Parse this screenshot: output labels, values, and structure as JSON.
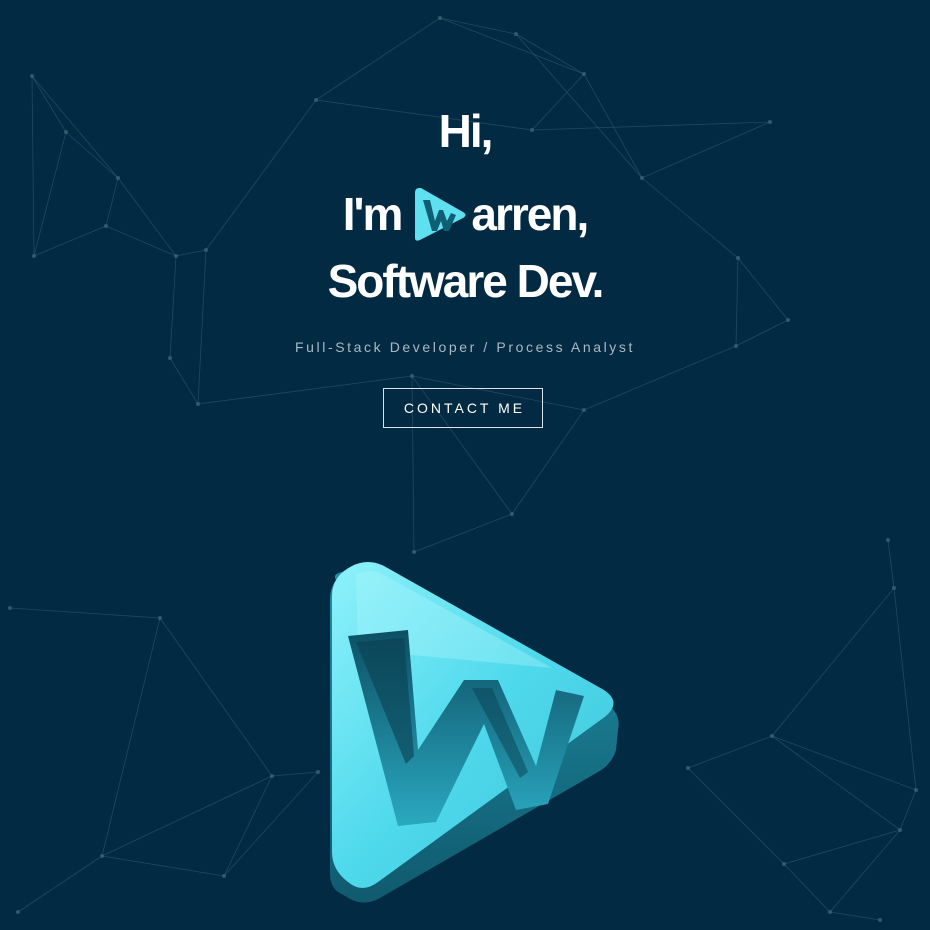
{
  "hero": {
    "greeting": "Hi,",
    "intro_prefix": "I'm",
    "intro_suffix": "arren,",
    "role_line": "Software Dev.",
    "subtitle": "Full-Stack Developer / Process Analyst"
  },
  "cta": {
    "contact_label": "CONTACT ME"
  },
  "logo": {
    "icon": "w-play-logo-icon",
    "letter": "W"
  },
  "colors": {
    "background": "#032a43",
    "accent": "#5ee0f0",
    "accent_dark": "#1b7f93",
    "network_lines": "#3d6178"
  }
}
